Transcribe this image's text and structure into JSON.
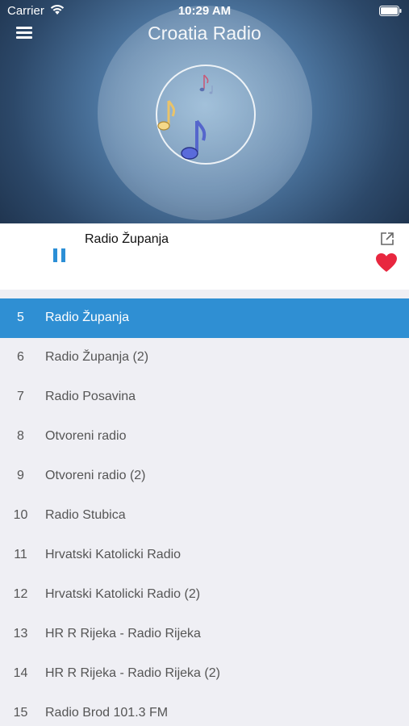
{
  "status_bar": {
    "carrier": "Carrier",
    "time": "10:29 AM"
  },
  "header": {
    "title": "Croatia Radio",
    "menu_icon": "hamburger-menu-icon"
  },
  "artwork": {
    "icons": [
      "music-note-icon",
      "music-note-icon",
      "music-note-icon"
    ]
  },
  "player": {
    "now_playing": "Radio Županja",
    "state": "playing",
    "controls": [
      "pause-icon",
      "share-icon",
      "heart-icon"
    ]
  },
  "colors": {
    "accent": "#2f8fd3",
    "favorite": "#e8273f",
    "list_background": "#efeff4"
  },
  "stations": [
    {
      "number": "5",
      "name": "Radio Županja",
      "active": true
    },
    {
      "number": "6",
      "name": "Radio Županja (2)",
      "active": false
    },
    {
      "number": "7",
      "name": "Radio Posavina",
      "active": false
    },
    {
      "number": "8",
      "name": "Otvoreni radio",
      "active": false
    },
    {
      "number": "9",
      "name": "Otvoreni radio (2)",
      "active": false
    },
    {
      "number": "10",
      "name": "Radio Stubica",
      "active": false
    },
    {
      "number": "11",
      "name": "Hrvatski Katolicki Radio",
      "active": false
    },
    {
      "number": "12",
      "name": "Hrvatski Katolicki Radio (2)",
      "active": false
    },
    {
      "number": "13",
      "name": "HR R Rijeka - Radio Rijeka",
      "active": false
    },
    {
      "number": "14",
      "name": "HR R Rijeka - Radio Rijeka (2)",
      "active": false
    },
    {
      "number": "15",
      "name": "Radio Brod 101.3 FM",
      "active": false
    }
  ]
}
